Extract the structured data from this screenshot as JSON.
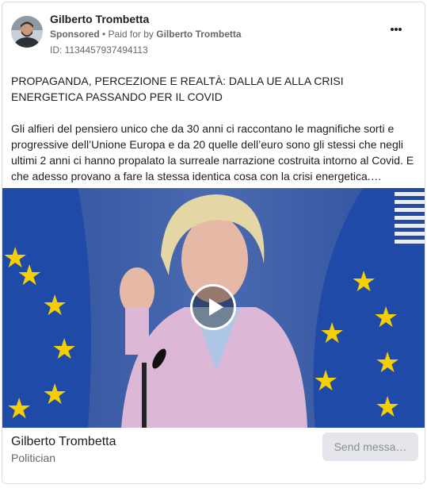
{
  "advertiser": {
    "name": "Gilberto Trombetta",
    "sponsored": "Sponsored",
    "separator": " • ",
    "paid_for_prefix": "Paid for by ",
    "paid_for_name": "Gilberto Trombetta",
    "ad_id": "ID: 1134457937494113",
    "more_icon": "more-horizontal-icon"
  },
  "post": {
    "title": "PROPAGANDA, PERCEZIONE E REALTÀ: DALLA UE ALLA CRISI ENERGETICA PASSANDO PER IL COVID",
    "body": "Gli alfieri del pensiero unico che da 30 anni ci raccontano le magnifiche sorti e progressive dell’Unione Europa e da 20 quelle dell’euro sono gli stessi che negli ultimi 2 anni ci hanno propalato la surreale narrazione costruita intorno al Covid. E che adesso provano a fare la stessa identica cosa con la crisi energetica.…"
  },
  "media": {
    "play_icon": "play-icon",
    "colors": {
      "eu_blue": "#1f4aa8",
      "eu_star": "#f5d000",
      "backdrop": "#3d5fa6"
    }
  },
  "footer": {
    "page_name": "Gilberto Trombetta",
    "page_category": "Politician",
    "cta_label": "Send messa…"
  }
}
